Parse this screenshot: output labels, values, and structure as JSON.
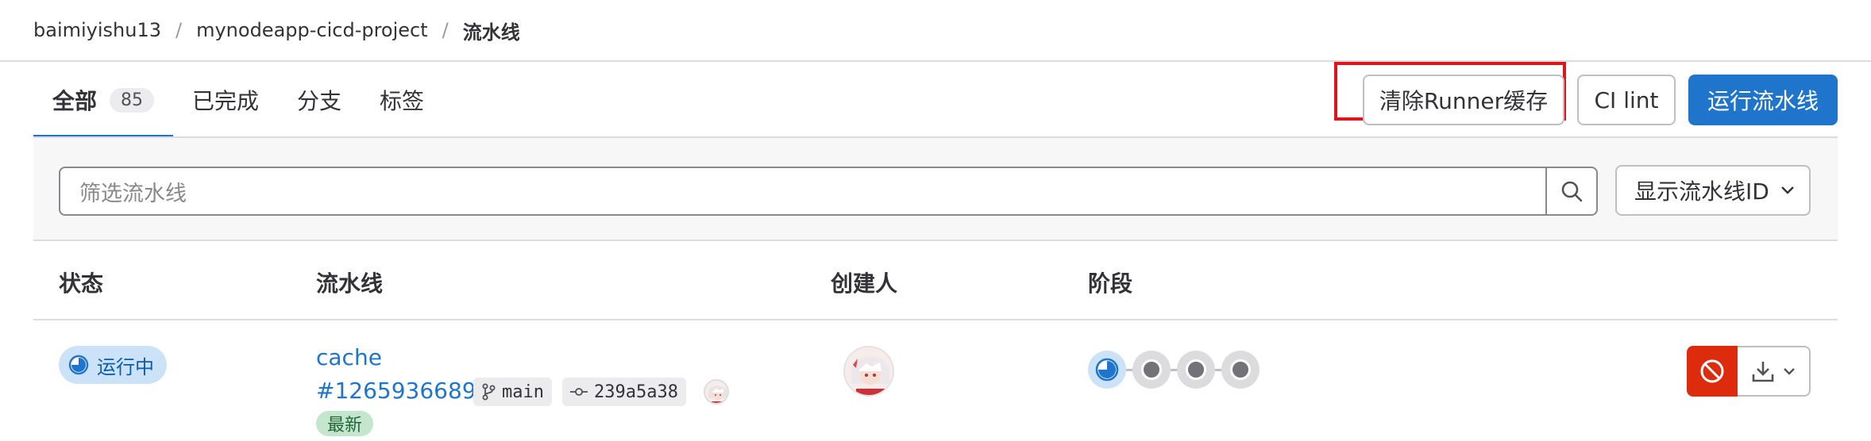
{
  "breadcrumb": {
    "items": [
      "baimiyishu13",
      "mynodeapp-cicd-project"
    ],
    "separator": "/",
    "current": "流水线"
  },
  "tabs": [
    {
      "label": "全部",
      "count": "85",
      "active": true
    },
    {
      "label": "已完成"
    },
    {
      "label": "分支"
    },
    {
      "label": "标签"
    }
  ],
  "actions": {
    "clear_cache": "清除Runner缓存",
    "ci_lint": "CI lint",
    "run_pipeline": "运行流水线"
  },
  "filter": {
    "placeholder": "筛选流水线",
    "display_option": "显示流水线ID"
  },
  "table": {
    "headers": [
      "状态",
      "流水线",
      "创建人",
      "阶段"
    ],
    "rows": [
      {
        "status": "运行中",
        "pipeline_name": "cache",
        "pipeline_id": "#1265936689",
        "branch": "main",
        "commit": "239a5a38",
        "badge": "最新",
        "stages": [
          "running",
          "pending",
          "pending",
          "pending"
        ]
      }
    ]
  },
  "colors": {
    "primary": "#1f75cb",
    "danger": "#dd2b0e",
    "highlight_box": "#e0141b",
    "running_badge_bg": "#cbe2f9",
    "latest_badge_bg": "#c3e6cd"
  }
}
